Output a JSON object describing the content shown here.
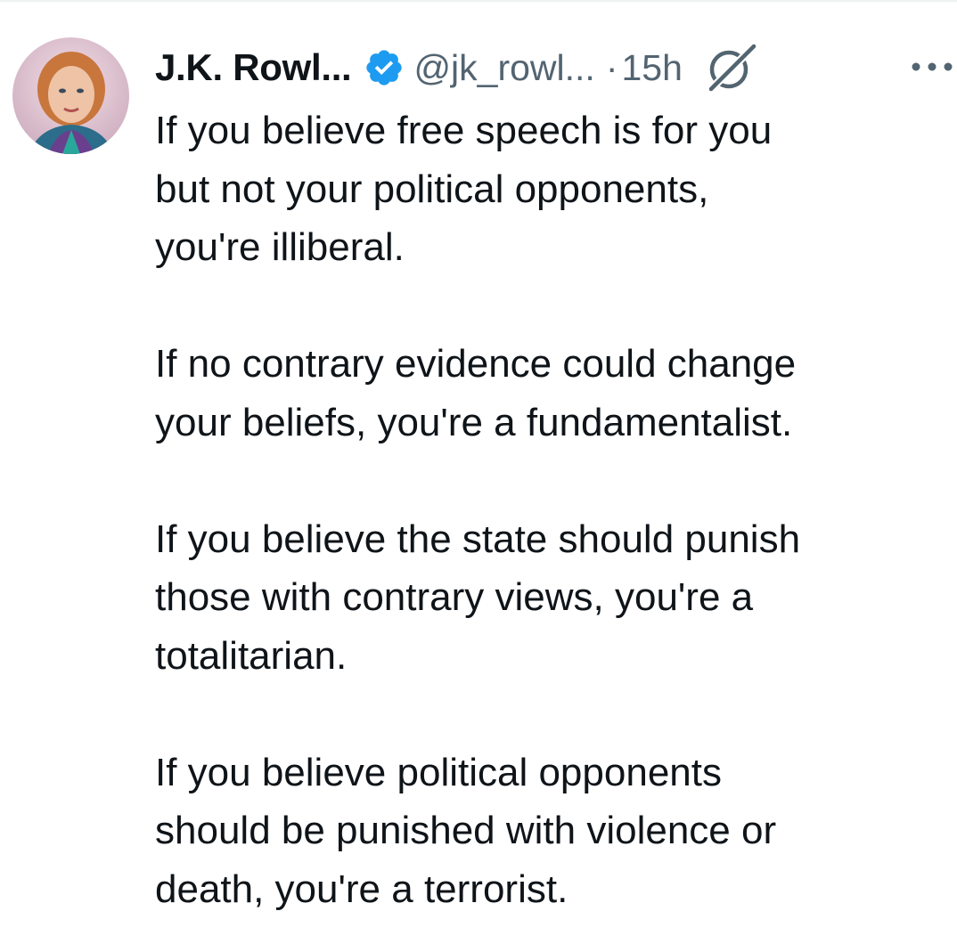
{
  "tweet": {
    "author": {
      "display_name": "J.K. Rowl...",
      "handle": "@jk_rowl...",
      "verified": true,
      "verified_icon": "verified-badge-icon",
      "avatar_icon": "profile-photo"
    },
    "separator": "·",
    "timestamp": "15h",
    "grok_icon": "grok-icon",
    "more_icon": "more-options-icon",
    "text": "If you believe free speech is for you\nbut not your political opponents,\nyou're illiberal.\n\nIf no contrary evidence could change\nyour beliefs, you're a fundamentalist.\n\nIf you believe the state should punish\nthose with contrary views, you're a\ntotalitarian.\n\nIf you believe political opponents\nshould be punished with violence or\ndeath, you're a terrorist."
  },
  "colors": {
    "text_primary": "#0f1419",
    "text_secondary": "#536471",
    "verified_blue": "#1d9bf0",
    "background": "#ffffff"
  }
}
